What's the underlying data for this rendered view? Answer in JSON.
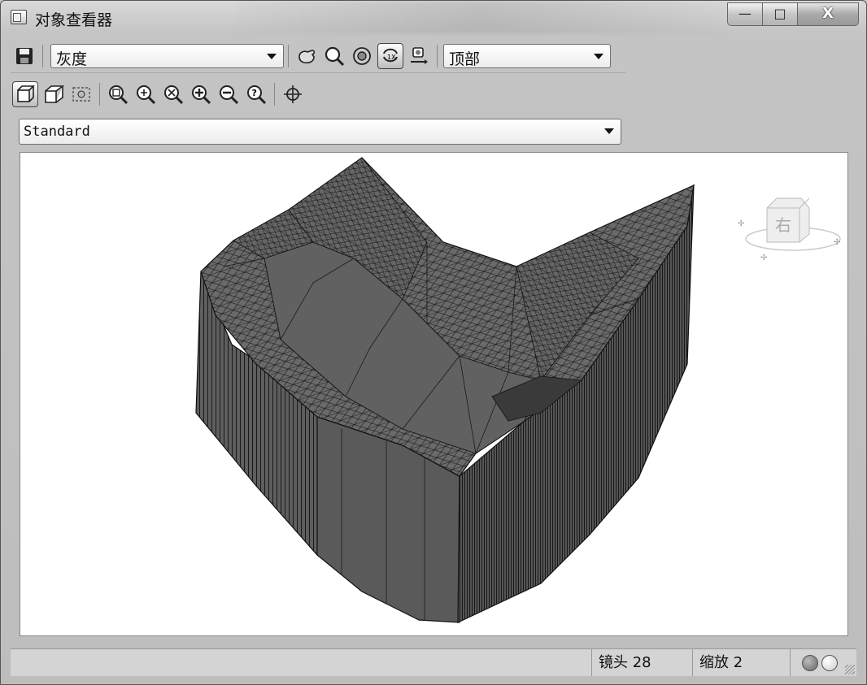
{
  "window": {
    "title": "对象查看器",
    "buttons": {
      "minimize": "—",
      "maximize": "□",
      "close": "X"
    }
  },
  "toolbar1": {
    "visual_style": "灰度",
    "view_direction": "顶部"
  },
  "toolbar2": {
    "preset": "Standard"
  },
  "viewcube": {
    "face_label": "右"
  },
  "status": {
    "lens": "镜头 28",
    "zoom": "缩放 2"
  },
  "colors": {
    "mesh_fill": "#5a5a5a",
    "mesh_light": "#707070",
    "mesh_edge": "#111111"
  }
}
